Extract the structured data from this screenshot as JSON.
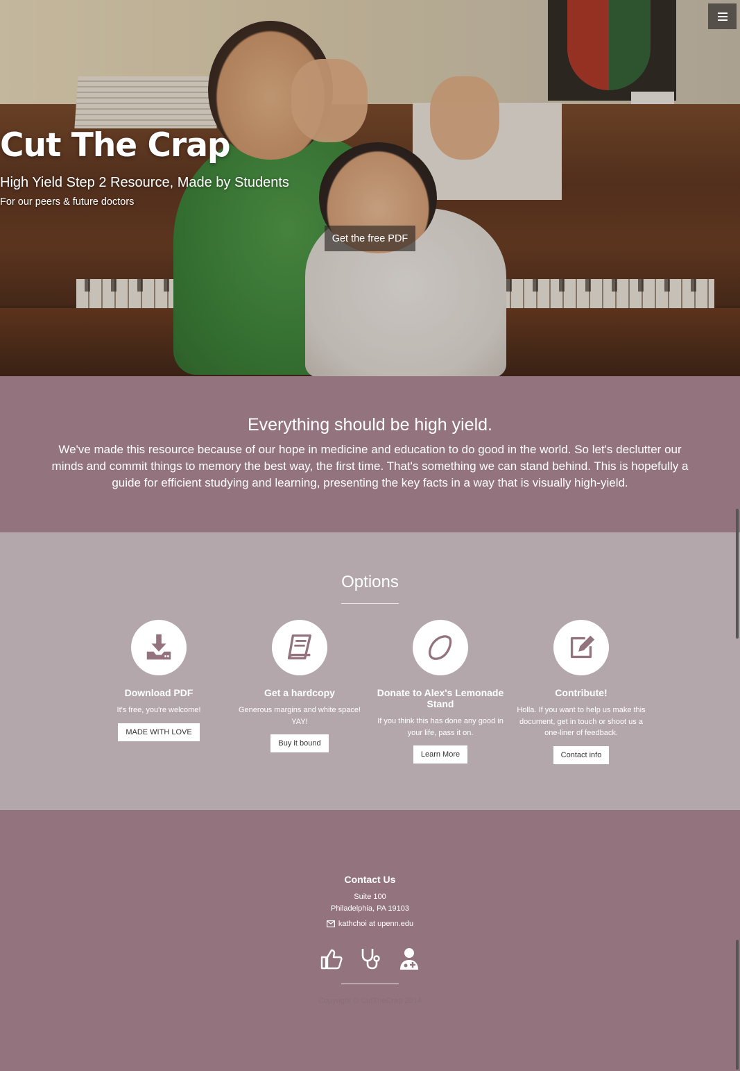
{
  "hero": {
    "title": "Cut The Crap",
    "subtitle": "High Yield Step 2 Resource, Made by Students",
    "tagline": "For our peers & future doctors",
    "cta_label": "Get the free PDF"
  },
  "intro": {
    "heading": "Everything should be high yield.",
    "body": "We've made this resource because of our hope in medicine and education to do good in the world. So let's declutter our minds and commit things to memory the best way, the first time. That's something we can stand behind. This is hopefully a guide for efficient studying and learning, presenting the key facts in a way that is visually high-yield."
  },
  "options": {
    "heading": "Options",
    "items": [
      {
        "icon": "download-icon",
        "title": "Download PDF",
        "text": "It's free, you're welcome!",
        "button": "MADE WITH LOVE"
      },
      {
        "icon": "book-icon",
        "title": "Get a hardcopy",
        "text": "Generous margins and white space! YAY!",
        "button": "Buy it bound"
      },
      {
        "icon": "lemon-icon",
        "title": "Donate to Alex's Lemonade Stand",
        "text": "If you think this has done any good in your life, pass it on.",
        "button": "Learn More"
      },
      {
        "icon": "edit-icon",
        "title": "Contribute!",
        "text": "Holla. If you want to help us make this document, get in touch or shoot us a one-liner of feedback.",
        "button": "Contact info"
      }
    ]
  },
  "footer": {
    "heading": "Contact Us",
    "address_line1": "Suite 100",
    "address_line2": "Philadelphia, PA 19103",
    "email": "kathchoi at upenn.edu",
    "social_icons": [
      "thumbs-up-icon",
      "stethoscope-icon",
      "user-doctor-icon"
    ],
    "copyright": "Copyright © CutTheCrap 2014"
  },
  "colors": {
    "primary": "#93737e",
    "options_bg": "#b3a7ab"
  }
}
